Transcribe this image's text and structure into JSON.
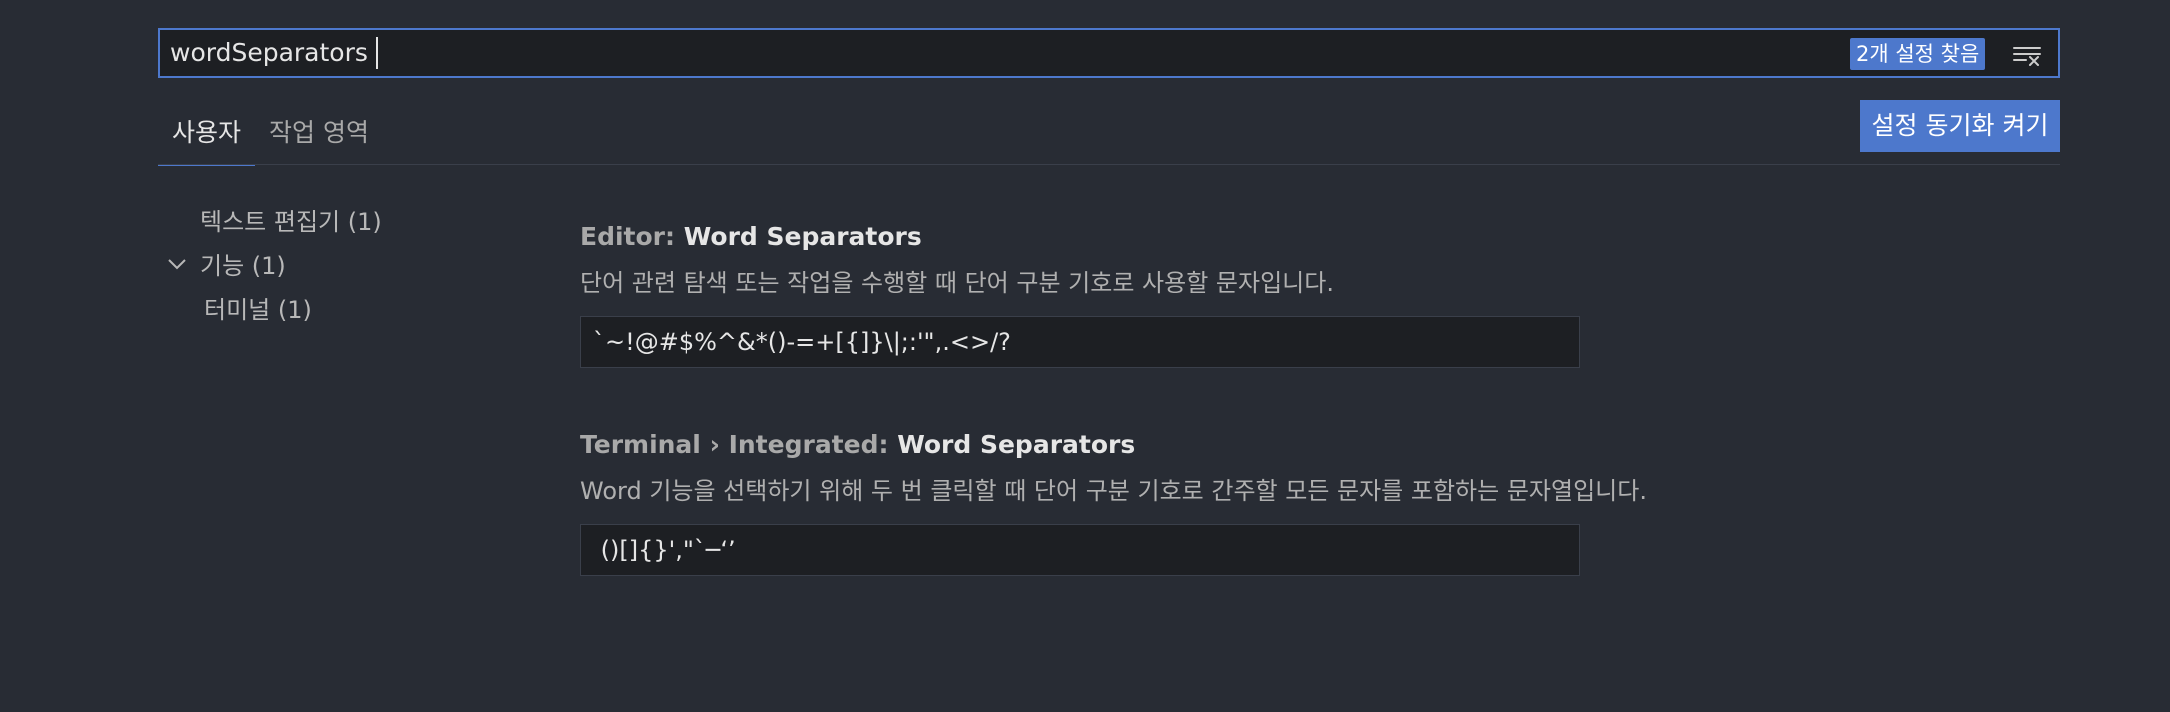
{
  "search": {
    "value": "wordSeparators",
    "result_count": "2개 설정 찾음"
  },
  "tabs": [
    {
      "label": "사용자",
      "active": true
    },
    {
      "label": "작업 영역",
      "active": false
    }
  ],
  "sync_button": "설정 동기화 켜기",
  "toc": [
    {
      "label": "텍스트 편집기 (1)"
    },
    {
      "label": "기능 (1)",
      "expanded": true
    },
    {
      "label": "터미널 (1)"
    }
  ],
  "settings": [
    {
      "category": "Editor: ",
      "name": "Word Separators",
      "description": "단어 관련 탐색 또는 작업을 수행할 때 단어 구분 기호로 사용할 문자입니다.",
      "value": "`~!@#$%^&*()-=+[{]}\\|;:'\",.<>/?"
    },
    {
      "category": "Terminal › Integrated: ",
      "name": "Word Separators",
      "description": "Word 기능을 선택하기 위해 두 번 클릭할 때 단어 구분 기호로 간주할 모든 문자를 포함하는 문자열입니다.",
      "value": " ()[]{}',\"`─‘’"
    }
  ],
  "colors": {
    "background": "#282c34",
    "accent": "#4d78cc",
    "input_background": "#1d1f23"
  }
}
